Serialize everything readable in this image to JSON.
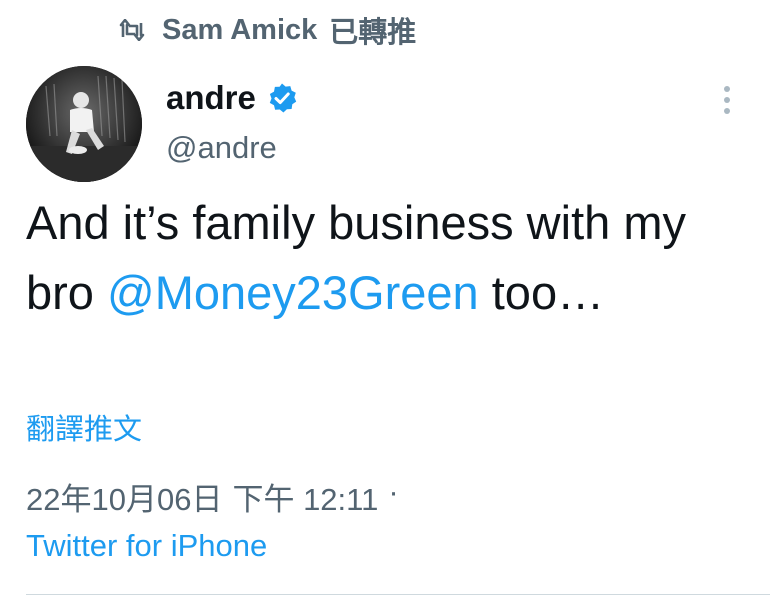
{
  "retweet": {
    "icon": "retweet-icon",
    "retweeter_name": "Sam Amick",
    "label": "已轉推"
  },
  "author": {
    "display_name": "andre",
    "handle": "@andre",
    "verified": true,
    "verified_icon": "verified-badge-icon",
    "avatar": "avatar-photo"
  },
  "menu": {
    "icon": "more-options-icon"
  },
  "tweet": {
    "text_part1": "And it’s family business with my bro ",
    "mention": "@Money23Green",
    "text_part2": " too…"
  },
  "translate_label": "翻譯推文",
  "timestamp": {
    "date": "22年10月06日",
    "time": "下午 12:11",
    "separator": "·"
  },
  "source": "Twitter for iPhone",
  "colors": {
    "accent": "#1d9bf0",
    "text": "#0f1419",
    "secondary": "#536471"
  }
}
